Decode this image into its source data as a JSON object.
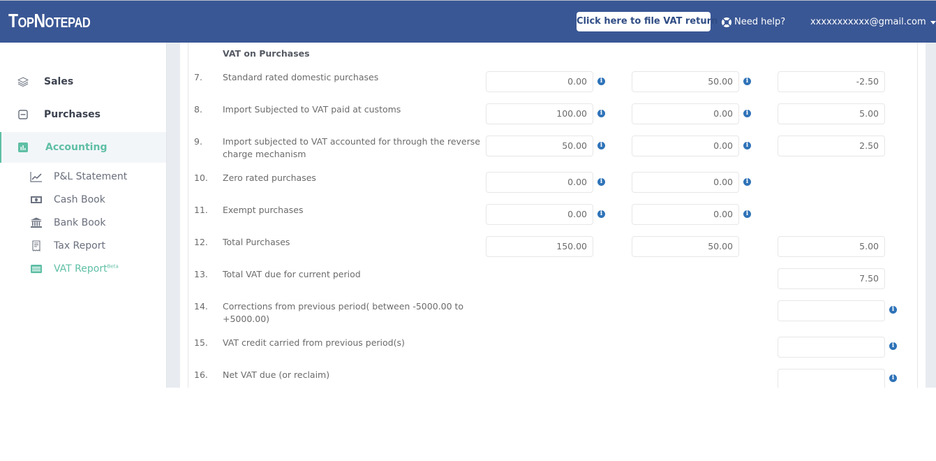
{
  "header": {
    "logo": "TopNotepad",
    "file_vat_button": "Click here to file VAT return",
    "help_label": "Need help?",
    "user_email": "xxxxxxxxxxx@gmail.com"
  },
  "sidebar": {
    "items": [
      {
        "label": "Sales",
        "icon": "layers-icon"
      },
      {
        "label": "Purchases",
        "icon": "minus-square-icon"
      },
      {
        "label": "Accounting",
        "icon": "bar-chart-icon",
        "active": true
      }
    ],
    "sub_items": [
      {
        "label": "P&L Statement",
        "icon": "line-chart-icon"
      },
      {
        "label": "Cash Book",
        "icon": "money-icon"
      },
      {
        "label": "Bank Book",
        "icon": "bank-icon"
      },
      {
        "label": "Tax Report",
        "icon": "receipt-icon"
      },
      {
        "label": "VAT Report",
        "badge": "Beta",
        "icon": "list-icon",
        "active": true
      }
    ]
  },
  "colors": {
    "header_bg": "#3a5795",
    "accent": "#5fbfa5",
    "info_icon": "#2f73b8"
  },
  "form": {
    "section_title": "VAT on Purchases",
    "rows": [
      {
        "num": "7.",
        "label": "Standard rated domestic purchases",
        "c1": "0.00",
        "c2": "50.00",
        "c3": "-2.50"
      },
      {
        "num": "8.",
        "label": "Import Subjected to VAT paid at customs",
        "c1": "100.00",
        "c2": "0.00",
        "c3": "5.00"
      },
      {
        "num": "9.",
        "label": "Import subjected to VAT accounted for through the reverse charge mechanism",
        "c1": "50.00",
        "c2": "0.00",
        "c3": "2.50"
      },
      {
        "num": "10.",
        "label": "Zero rated purchases",
        "c1": "0.00",
        "c2": "0.00"
      },
      {
        "num": "11.",
        "label": "Exempt purchases",
        "c1": "0.00",
        "c2": "0.00"
      },
      {
        "num": "12.",
        "label": "Total Purchases",
        "c1": "150.00",
        "c2": "50.00",
        "c3": "5.00"
      },
      {
        "num": "13.",
        "label": "Total VAT due for current period",
        "c3": "7.50"
      },
      {
        "num": "14.",
        "label": "Corrections from previous period( between -5000.00 to +5000.00)",
        "c3": ""
      },
      {
        "num": "15.",
        "label": "VAT credit carried from previous period(s)",
        "c3": ""
      },
      {
        "num": "16.",
        "label": "Net VAT due (or reclaim)",
        "c3": ""
      }
    ]
  }
}
